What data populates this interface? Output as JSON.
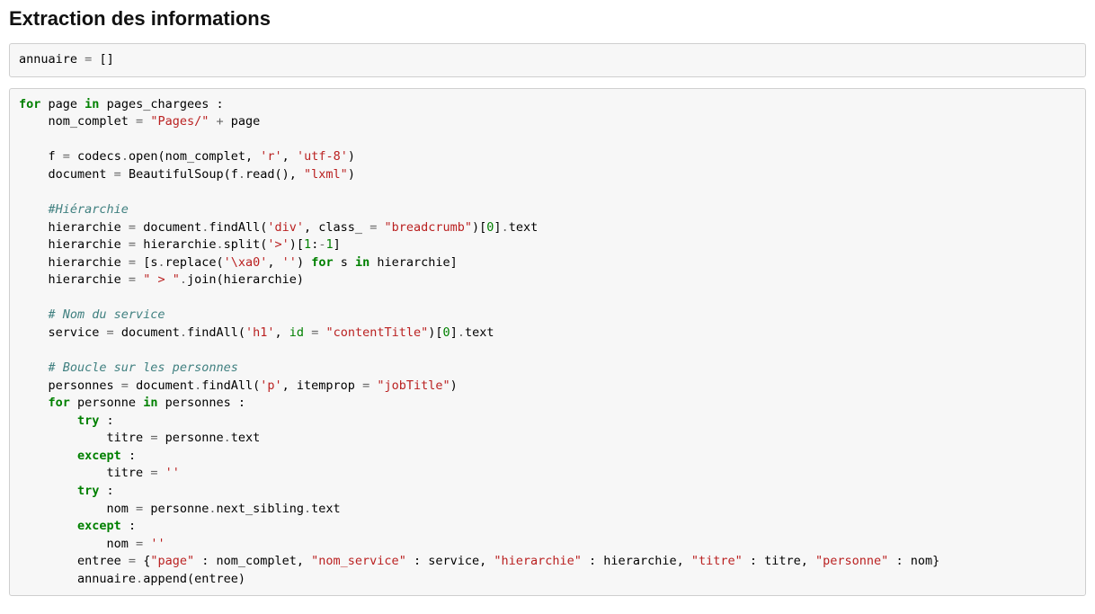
{
  "heading": "Extraction des informations",
  "cells": [
    {
      "code_tokens": [
        {
          "t": "annuaire",
          "c": "n"
        },
        {
          "t": " ",
          "c": "p"
        },
        {
          "t": "=",
          "c": "o"
        },
        {
          "t": " []",
          "c": "p"
        }
      ]
    },
    {
      "code_tokens": [
        {
          "t": "for",
          "c": "k"
        },
        {
          "t": " page ",
          "c": "n"
        },
        {
          "t": "in",
          "c": "k"
        },
        {
          "t": " pages_chargees :",
          "c": "n"
        },
        {
          "t": "\n",
          "c": "p"
        },
        {
          "t": "    nom_complet ",
          "c": "n"
        },
        {
          "t": "=",
          "c": "o"
        },
        {
          "t": " ",
          "c": "p"
        },
        {
          "t": "\"Pages/\"",
          "c": "s"
        },
        {
          "t": " ",
          "c": "p"
        },
        {
          "t": "+",
          "c": "o"
        },
        {
          "t": " page",
          "c": "n"
        },
        {
          "t": "\n",
          "c": "p"
        },
        {
          "t": "\n",
          "c": "p"
        },
        {
          "t": "    f ",
          "c": "n"
        },
        {
          "t": "=",
          "c": "o"
        },
        {
          "t": " codecs",
          "c": "n"
        },
        {
          "t": ".",
          "c": "o"
        },
        {
          "t": "open(nom_complet, ",
          "c": "n"
        },
        {
          "t": "'r'",
          "c": "s"
        },
        {
          "t": ", ",
          "c": "p"
        },
        {
          "t": "'utf-8'",
          "c": "s"
        },
        {
          "t": ")",
          "c": "p"
        },
        {
          "t": "\n",
          "c": "p"
        },
        {
          "t": "    document ",
          "c": "n"
        },
        {
          "t": "=",
          "c": "o"
        },
        {
          "t": " BeautifulSoup(f",
          "c": "n"
        },
        {
          "t": ".",
          "c": "o"
        },
        {
          "t": "read(), ",
          "c": "n"
        },
        {
          "t": "\"lxml\"",
          "c": "s"
        },
        {
          "t": ")",
          "c": "p"
        },
        {
          "t": "\n",
          "c": "p"
        },
        {
          "t": "\n",
          "c": "p"
        },
        {
          "t": "    ",
          "c": "p"
        },
        {
          "t": "#Hiérarchie",
          "c": "c"
        },
        {
          "t": "\n",
          "c": "p"
        },
        {
          "t": "    hierarchie ",
          "c": "n"
        },
        {
          "t": "=",
          "c": "o"
        },
        {
          "t": " document",
          "c": "n"
        },
        {
          "t": ".",
          "c": "o"
        },
        {
          "t": "findAll(",
          "c": "n"
        },
        {
          "t": "'div'",
          "c": "s"
        },
        {
          "t": ", class_ ",
          "c": "n"
        },
        {
          "t": "=",
          "c": "o"
        },
        {
          "t": " ",
          "c": "p"
        },
        {
          "t": "\"breadcrumb\"",
          "c": "s"
        },
        {
          "t": ")[",
          "c": "p"
        },
        {
          "t": "0",
          "c": "mi"
        },
        {
          "t": "]",
          "c": "p"
        },
        {
          "t": ".",
          "c": "o"
        },
        {
          "t": "text",
          "c": "n"
        },
        {
          "t": "\n",
          "c": "p"
        },
        {
          "t": "    hierarchie ",
          "c": "n"
        },
        {
          "t": "=",
          "c": "o"
        },
        {
          "t": " hierarchie",
          "c": "n"
        },
        {
          "t": ".",
          "c": "o"
        },
        {
          "t": "split(",
          "c": "n"
        },
        {
          "t": "'>'",
          "c": "s"
        },
        {
          "t": ")[",
          "c": "p"
        },
        {
          "t": "1",
          "c": "mi"
        },
        {
          "t": ":",
          "c": "p"
        },
        {
          "t": "-",
          "c": "o"
        },
        {
          "t": "1",
          "c": "mi"
        },
        {
          "t": "]",
          "c": "p"
        },
        {
          "t": "\n",
          "c": "p"
        },
        {
          "t": "    hierarchie ",
          "c": "n"
        },
        {
          "t": "=",
          "c": "o"
        },
        {
          "t": " [s",
          "c": "n"
        },
        {
          "t": ".",
          "c": "o"
        },
        {
          "t": "replace(",
          "c": "n"
        },
        {
          "t": "'\\xa0'",
          "c": "s"
        },
        {
          "t": ", ",
          "c": "p"
        },
        {
          "t": "''",
          "c": "s"
        },
        {
          "t": ") ",
          "c": "p"
        },
        {
          "t": "for",
          "c": "k"
        },
        {
          "t": " s ",
          "c": "n"
        },
        {
          "t": "in",
          "c": "k"
        },
        {
          "t": " hierarchie]",
          "c": "n"
        },
        {
          "t": "\n",
          "c": "p"
        },
        {
          "t": "    hierarchie ",
          "c": "n"
        },
        {
          "t": "=",
          "c": "o"
        },
        {
          "t": " ",
          "c": "p"
        },
        {
          "t": "\" > \"",
          "c": "s"
        },
        {
          "t": ".",
          "c": "o"
        },
        {
          "t": "join(hierarchie)",
          "c": "n"
        },
        {
          "t": "\n",
          "c": "p"
        },
        {
          "t": "\n",
          "c": "p"
        },
        {
          "t": "    ",
          "c": "p"
        },
        {
          "t": "# Nom du service",
          "c": "c"
        },
        {
          "t": "\n",
          "c": "p"
        },
        {
          "t": "    service ",
          "c": "n"
        },
        {
          "t": "=",
          "c": "o"
        },
        {
          "t": " document",
          "c": "n"
        },
        {
          "t": ".",
          "c": "o"
        },
        {
          "t": "findAll(",
          "c": "n"
        },
        {
          "t": "'h1'",
          "c": "s"
        },
        {
          "t": ", ",
          "c": "p"
        },
        {
          "t": "id",
          "c": "nb"
        },
        {
          "t": " ",
          "c": "p"
        },
        {
          "t": "=",
          "c": "o"
        },
        {
          "t": " ",
          "c": "p"
        },
        {
          "t": "\"contentTitle\"",
          "c": "s"
        },
        {
          "t": ")[",
          "c": "p"
        },
        {
          "t": "0",
          "c": "mi"
        },
        {
          "t": "]",
          "c": "p"
        },
        {
          "t": ".",
          "c": "o"
        },
        {
          "t": "text",
          "c": "n"
        },
        {
          "t": "\n",
          "c": "p"
        },
        {
          "t": "\n",
          "c": "p"
        },
        {
          "t": "    ",
          "c": "p"
        },
        {
          "t": "# Boucle sur les personnes",
          "c": "c"
        },
        {
          "t": "\n",
          "c": "p"
        },
        {
          "t": "    personnes ",
          "c": "n"
        },
        {
          "t": "=",
          "c": "o"
        },
        {
          "t": " document",
          "c": "n"
        },
        {
          "t": ".",
          "c": "o"
        },
        {
          "t": "findAll(",
          "c": "n"
        },
        {
          "t": "'p'",
          "c": "s"
        },
        {
          "t": ", itemprop ",
          "c": "n"
        },
        {
          "t": "=",
          "c": "o"
        },
        {
          "t": " ",
          "c": "p"
        },
        {
          "t": "\"jobTitle\"",
          "c": "s"
        },
        {
          "t": ")",
          "c": "p"
        },
        {
          "t": "\n",
          "c": "p"
        },
        {
          "t": "    ",
          "c": "p"
        },
        {
          "t": "for",
          "c": "k"
        },
        {
          "t": " personne ",
          "c": "n"
        },
        {
          "t": "in",
          "c": "k"
        },
        {
          "t": " personnes :",
          "c": "n"
        },
        {
          "t": "\n",
          "c": "p"
        },
        {
          "t": "        ",
          "c": "p"
        },
        {
          "t": "try",
          "c": "k"
        },
        {
          "t": " :",
          "c": "p"
        },
        {
          "t": "\n",
          "c": "p"
        },
        {
          "t": "            titre ",
          "c": "n"
        },
        {
          "t": "=",
          "c": "o"
        },
        {
          "t": " personne",
          "c": "n"
        },
        {
          "t": ".",
          "c": "o"
        },
        {
          "t": "text",
          "c": "n"
        },
        {
          "t": "\n",
          "c": "p"
        },
        {
          "t": "        ",
          "c": "p"
        },
        {
          "t": "except",
          "c": "k"
        },
        {
          "t": " :",
          "c": "p"
        },
        {
          "t": "\n",
          "c": "p"
        },
        {
          "t": "            titre ",
          "c": "n"
        },
        {
          "t": "=",
          "c": "o"
        },
        {
          "t": " ",
          "c": "p"
        },
        {
          "t": "''",
          "c": "s"
        },
        {
          "t": "\n",
          "c": "p"
        },
        {
          "t": "        ",
          "c": "p"
        },
        {
          "t": "try",
          "c": "k"
        },
        {
          "t": " :",
          "c": "p"
        },
        {
          "t": "\n",
          "c": "p"
        },
        {
          "t": "            nom ",
          "c": "n"
        },
        {
          "t": "=",
          "c": "o"
        },
        {
          "t": " personne",
          "c": "n"
        },
        {
          "t": ".",
          "c": "o"
        },
        {
          "t": "next_sibling",
          "c": "n"
        },
        {
          "t": ".",
          "c": "o"
        },
        {
          "t": "text",
          "c": "n"
        },
        {
          "t": "\n",
          "c": "p"
        },
        {
          "t": "        ",
          "c": "p"
        },
        {
          "t": "except",
          "c": "k"
        },
        {
          "t": " :",
          "c": "p"
        },
        {
          "t": "\n",
          "c": "p"
        },
        {
          "t": "            nom ",
          "c": "n"
        },
        {
          "t": "=",
          "c": "o"
        },
        {
          "t": " ",
          "c": "p"
        },
        {
          "t": "''",
          "c": "s"
        },
        {
          "t": "\n",
          "c": "p"
        },
        {
          "t": "        entree ",
          "c": "n"
        },
        {
          "t": "=",
          "c": "o"
        },
        {
          "t": " {",
          "c": "p"
        },
        {
          "t": "\"page\"",
          "c": "s"
        },
        {
          "t": " : nom_complet, ",
          "c": "n"
        },
        {
          "t": "\"nom_service\"",
          "c": "s"
        },
        {
          "t": " : service, ",
          "c": "n"
        },
        {
          "t": "\"hierarchie\"",
          "c": "s"
        },
        {
          "t": " : hierarchie, ",
          "c": "n"
        },
        {
          "t": "\"titre\"",
          "c": "s"
        },
        {
          "t": " : titre, ",
          "c": "n"
        },
        {
          "t": "\"personne\"",
          "c": "s"
        },
        {
          "t": " : nom}",
          "c": "n"
        },
        {
          "t": "\n",
          "c": "p"
        },
        {
          "t": "        annuaire",
          "c": "n"
        },
        {
          "t": ".",
          "c": "o"
        },
        {
          "t": "append(entree)",
          "c": "n"
        }
      ]
    }
  ]
}
